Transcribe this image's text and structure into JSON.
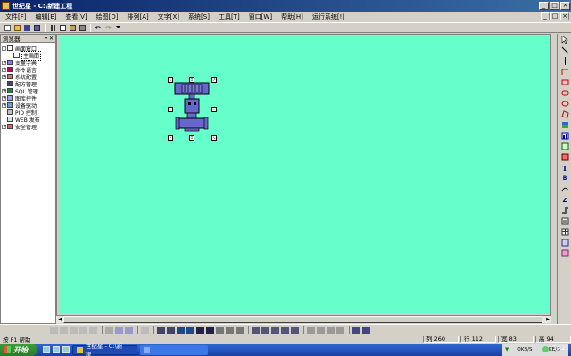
{
  "window": {
    "title": "世纪星 - C:\\新建工程",
    "ctrl_min": "_",
    "ctrl_max": "□",
    "ctrl_close": "×"
  },
  "menu": {
    "items": [
      "文件[F]",
      "编辑[E]",
      "查看[V]",
      "绘图[D]",
      "排列[A]",
      "文字[X]",
      "系统[S]",
      "工具[T]",
      "窗口[W]",
      "帮助[H]",
      "运行系统[!]"
    ]
  },
  "toolbar": {
    "icons": [
      "new-icon",
      "open-icon",
      "save-icon",
      "save-all-icon",
      "cut-icon",
      "copy-icon",
      "paste-icon",
      "delete-icon",
      "undo-icon",
      "redo-icon",
      "dropdown-icon"
    ]
  },
  "explorer": {
    "title": "浏览器",
    "pin": "▾ ✕",
    "items": [
      {
        "label": "画面窗口",
        "expand": "-",
        "child": false,
        "color": "#ffffff"
      },
      {
        "label": "主画面",
        "expand": "",
        "child": true,
        "selected": true,
        "color": "#ffffff"
      },
      {
        "label": "变量字典",
        "expand": "+",
        "child": false,
        "color": "#8080ff"
      },
      {
        "label": "命令语言",
        "expand": "+",
        "child": false,
        "color": "#c00060"
      },
      {
        "label": "系统配置",
        "expand": "+",
        "child": false,
        "color": "#ff6060"
      },
      {
        "label": "配方管理",
        "expand": "",
        "child": false,
        "color": "#404080"
      },
      {
        "label": "SQL 管理",
        "expand": "+",
        "child": false,
        "color": "#208040"
      },
      {
        "label": "图库控件",
        "expand": "+",
        "child": false,
        "color": "#a0a0ff"
      },
      {
        "label": "设备驱动",
        "expand": "+",
        "child": false,
        "color": "#60a0e0"
      },
      {
        "label": "PID 控制",
        "expand": "",
        "child": false,
        "color": "#c0c0c0"
      },
      {
        "label": "WEB 发布",
        "expand": "",
        "child": false,
        "color": "#e0e0e0"
      },
      {
        "label": "安全管理",
        "expand": "+",
        "child": false,
        "color": "#e06060"
      }
    ]
  },
  "statusbar": {
    "hint": "按 F1 帮助",
    "col": "列 260",
    "row": "行 112",
    "width": "宽 83",
    "height": "高 94"
  },
  "taskbar": {
    "start": "开始",
    "task_active": "世纪星 - C:\\新建...",
    "net_down": "0KB/S",
    "net_up": "0KB/S",
    "clock": "14:23"
  },
  "colors": {
    "canvas_bg": "#66ffcc",
    "object_fill": "#6666cc"
  }
}
